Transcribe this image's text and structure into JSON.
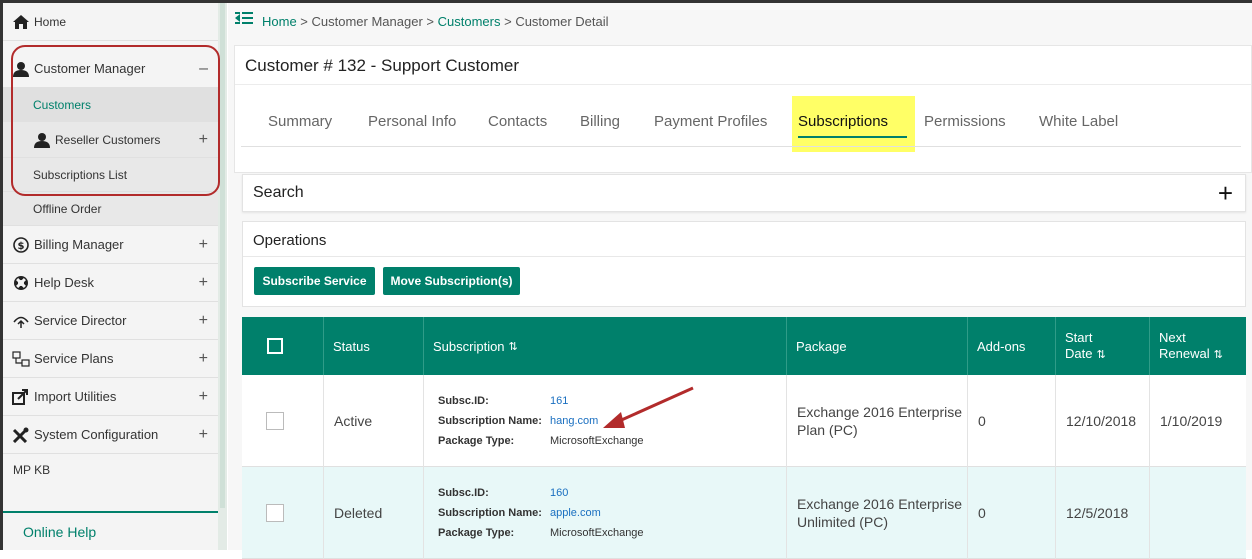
{
  "sidebar": {
    "home": "Home",
    "customer_manager": "Customer Manager",
    "customers": "Customers",
    "reseller_customers": "Reseller Customers",
    "subscriptions_list": "Subscriptions List",
    "offline_order": "Offline Order",
    "billing_manager": "Billing Manager",
    "help_desk": "Help Desk",
    "service_director": "Service Director",
    "service_plans": "Service Plans",
    "import_utilities": "Import Utilities",
    "system_configuration": "System Configuration",
    "mp_kb": "MP KB",
    "online_help": "Online Help",
    "collapse_symbol": "–",
    "expand_symbol": "+"
  },
  "breadcrumb": {
    "home": "Home",
    "sep": " > ",
    "customer_manager": "Customer Manager",
    "customers": "Customers",
    "current": "Customer Detail"
  },
  "page": {
    "title": "Customer # 132 - Support Customer"
  },
  "tabs": [
    "Summary",
    "Personal Info",
    "Contacts",
    "Billing",
    "Payment Profiles",
    "Subscriptions",
    "Permissions",
    "White Label"
  ],
  "active_tab": "Subscriptions",
  "search": {
    "label": "Search",
    "toggle": "+"
  },
  "operations": {
    "label": "Operations",
    "subscribe_button": "Subscribe Service",
    "move_button": "Move Subscription(s)"
  },
  "table": {
    "headers": {
      "status": "Status",
      "subscription": "Subscription",
      "package": "Package",
      "addons": "Add-ons",
      "start_date_1": "Start",
      "start_date_2": "Date",
      "next_renewal_1": "Next",
      "next_renewal_2": "Renewal",
      "sort_icon": "⇅"
    },
    "labels": {
      "subsc_id": "Subsc.ID:",
      "subscription_name": "Subscription Name:",
      "package_type": "Package Type:"
    },
    "rows": [
      {
        "status": "Active",
        "subsc_id": "161",
        "subscription_name": "hang.com",
        "package_type": "MicrosoftExchange",
        "package": "Exchange 2016 Enterprise Plan (PC)",
        "addons": "0",
        "start_date": "12/10/2018",
        "next_renewal": "1/10/2019"
      },
      {
        "status": "Deleted",
        "subsc_id": "160",
        "subscription_name": "apple.com",
        "package_type": "MicrosoftExchange",
        "package": "Exchange 2016 Enterprise Unlimited (PC)",
        "addons": "0",
        "start_date": "12/5/2018",
        "next_renewal": ""
      }
    ]
  },
  "colors": {
    "accent": "#00806b",
    "highlight": "#ffff66",
    "annotation_red": "#b22b2b",
    "link_blue": "#1a6fc0"
  }
}
